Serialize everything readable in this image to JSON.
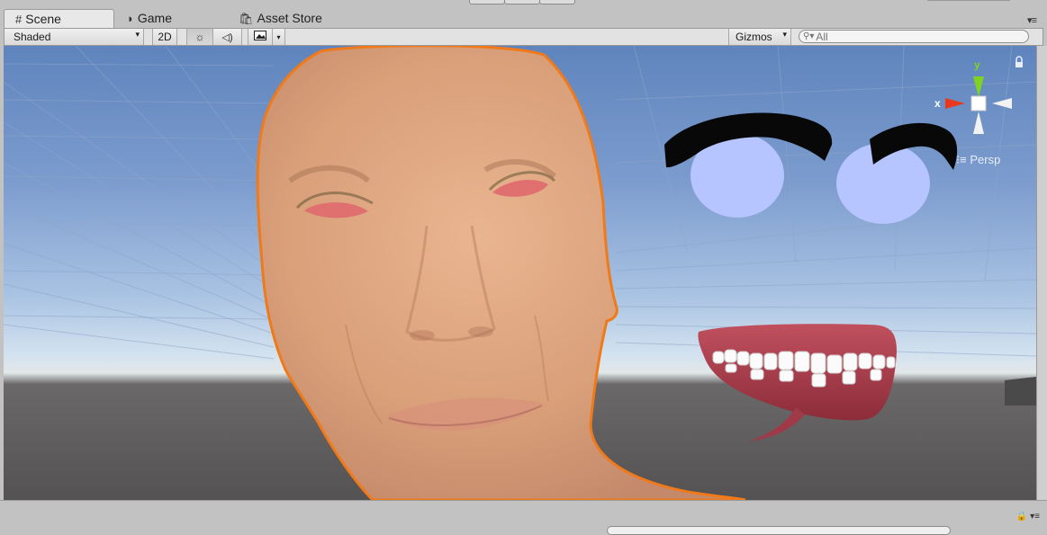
{
  "tabs": [
    {
      "label": "Scene",
      "icon": "scene-grid-icon",
      "active": true
    },
    {
      "label": "Game",
      "icon": "pacman-icon",
      "active": false
    },
    {
      "label": "Asset Store",
      "icon": "shopping-bag-icon",
      "active": false
    }
  ],
  "toolbar": {
    "draw_mode": "Shaded",
    "mode_2d": "2D",
    "gizmos": "Gizmos",
    "search_placeholder": "All"
  },
  "orientation_gizmo": {
    "y_label": "y",
    "x_label": "x",
    "projection": "Persp"
  },
  "colors": {
    "selection_outline": "#f07a1a",
    "sky_top": "#5f84bd",
    "ground": "#545252",
    "eye_white": "#b6c4ff",
    "eyelid": "#e07070",
    "gums": "#b64455"
  }
}
